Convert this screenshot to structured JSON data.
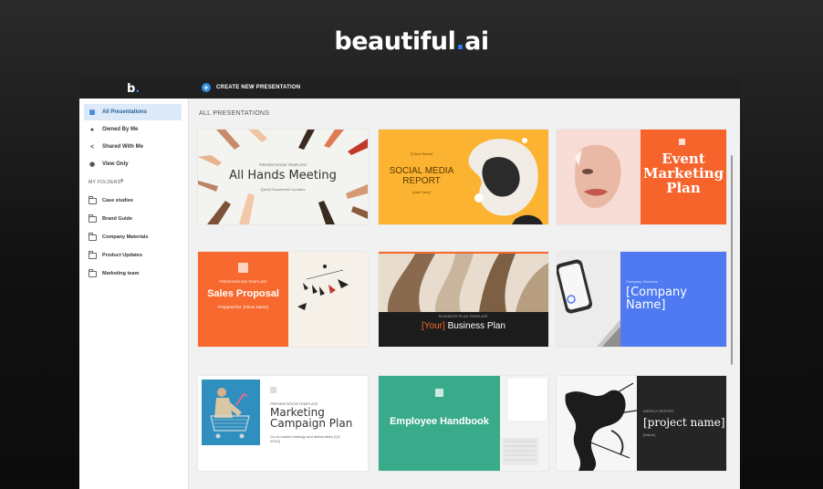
{
  "brand": {
    "name_main": "beautiful",
    "name_dot": ".",
    "name_suffix": "ai"
  },
  "app": {
    "logo": {
      "letter": "b",
      "dot": "."
    },
    "create_button": {
      "label": "CREATE NEW PRESENTATION",
      "icon": "plus-icon"
    },
    "sidebar": {
      "items": [
        {
          "label": "All Presentations",
          "icon": "grid-icon",
          "active": true
        },
        {
          "label": "Owned By Me",
          "icon": "user-icon"
        },
        {
          "label": "Shared With Me",
          "icon": "share-icon"
        },
        {
          "label": "View Only",
          "icon": "eye-icon"
        }
      ],
      "folders_label": "MY FOLDERS",
      "folders_add": "+",
      "folders": [
        {
          "label": "Case studies"
        },
        {
          "label": "Brand Guide"
        },
        {
          "label": "Company Materials"
        },
        {
          "label": "Product Updates"
        },
        {
          "label": "Marketing team"
        }
      ]
    },
    "main": {
      "title": "ALL PRESENTATIONS",
      "cards": [
        {
          "title": "All Hands Meeting",
          "kicker": "PRESENTATION TEMPLATE",
          "subtitle": "[Q&A] Department Updates"
        },
        {
          "title": "SOCIAL MEDIA",
          "title2": "REPORT",
          "kicker": "[Client Name]",
          "subtitle": "[date here]"
        },
        {
          "title": "Event",
          "title2": "Marketing",
          "title3": "Plan"
        },
        {
          "title": "Sales Proposal",
          "kicker": "PRESENTATION TEMPLATE",
          "subtitle": "Prepared for: [Client Name]"
        },
        {
          "title_accent": "[Your]",
          "title": " Business Plan",
          "kicker": "BUSINESS PLAN TEMPLATE"
        },
        {
          "title": "[Company",
          "title2": "Name]",
          "kicker": "Company Overview"
        },
        {
          "title": "Marketing",
          "title2": "Campaign Plan",
          "kicker": "PRESENTATION TEMPLATE",
          "subtitle": "Go-to-market strategy and deliverables [Q4 20XX]"
        },
        {
          "title": "Employee Handbook"
        },
        {
          "title": "[project name]",
          "kicker": "WEEKLY REPORT",
          "subtitle": "[Name]"
        }
      ]
    }
  },
  "colors": {
    "accent": "#2f7ef0",
    "orange": "#f7692e",
    "yellow": "#fbb331",
    "blue": "#4f7af2",
    "teal": "#3aab8a",
    "dark": "#252525"
  }
}
